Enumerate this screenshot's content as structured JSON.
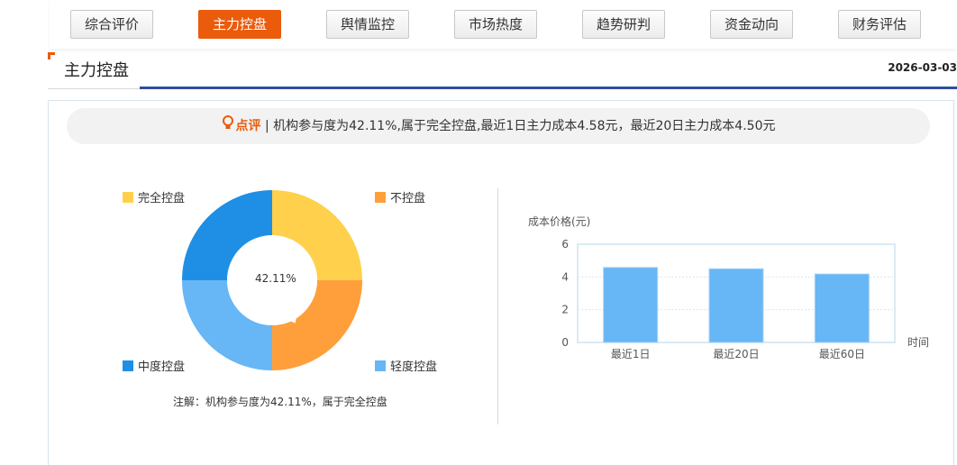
{
  "tabs": [
    {
      "label": "综合评价",
      "active": false
    },
    {
      "label": "主力控盘",
      "active": true
    },
    {
      "label": "舆情监控",
      "active": false
    },
    {
      "label": "市场热度",
      "active": false
    },
    {
      "label": "趋势研判",
      "active": false
    },
    {
      "label": "资金动向",
      "active": false
    },
    {
      "label": "财务评估",
      "active": false
    }
  ],
  "section": {
    "title": "主力控盘",
    "date": "2026-03-03"
  },
  "comment": {
    "label": "点评",
    "text": " | 机构参与度为42.11%,属于完全控盘,最近1日主力成本4.58元，最近20日主力成本4.50元"
  },
  "colors": {
    "accent": "#ea5b0c",
    "full": "#ffd04b",
    "none": "#ff9f3b",
    "light": "#67b6f5",
    "mid": "#1f8fe5",
    "bar": "#67b6f5",
    "bar_border": "#a8d2f6"
  },
  "donut": {
    "center_label": "42.11%",
    "legend": {
      "full": "完全控盘",
      "none": "不控盘",
      "mid": "中度控盘",
      "light": "轻度控盘"
    }
  },
  "note": "注解：机构参与度为42.11%，属于完全控盘",
  "chart_data": [
    {
      "type": "pie",
      "labels": [
        "完全控盘",
        "不控盘",
        "轻度控盘",
        "中度控盘"
      ],
      "values": [
        25,
        25,
        25,
        25
      ],
      "annotation": "42.11%",
      "pointer_value": 42.11
    },
    {
      "type": "bar",
      "categories": [
        "最近1日",
        "最近20日",
        "最近60日"
      ],
      "values": [
        4.58,
        4.5,
        4.18
      ],
      "ylabel": "成本价格(元)",
      "xlabel": "时间",
      "ylim": [
        0,
        6
      ],
      "yticks": [
        "0",
        "2",
        "4",
        "6"
      ]
    }
  ]
}
